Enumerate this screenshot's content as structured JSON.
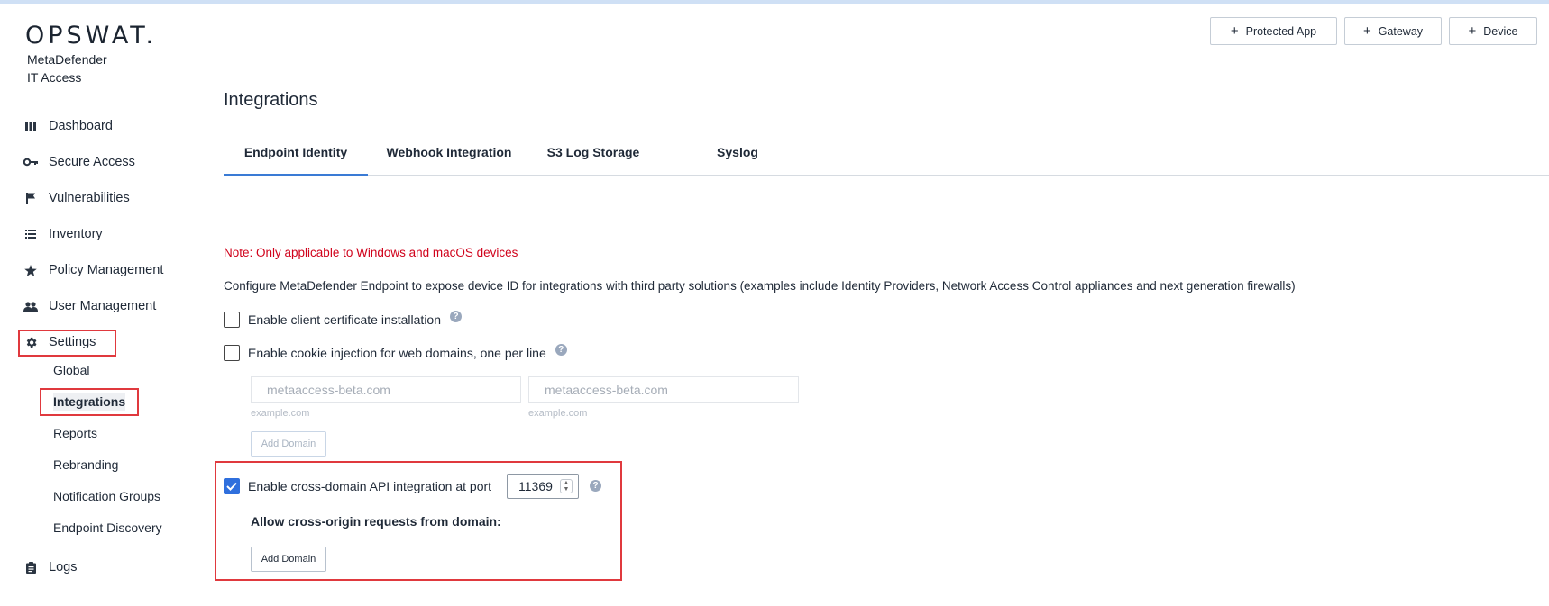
{
  "brand": {
    "logo": "OPSWAT.",
    "product_line1": "MetaDefender",
    "product_line2": "IT Access"
  },
  "header_buttons": [
    {
      "label": "Protected App"
    },
    {
      "label": "Gateway"
    },
    {
      "label": "Device"
    }
  ],
  "sidebar": {
    "items": [
      {
        "label": "Dashboard",
        "icon": "dashboard-icon"
      },
      {
        "label": "Secure Access",
        "icon": "key-icon"
      },
      {
        "label": "Vulnerabilities",
        "icon": "flag-icon"
      },
      {
        "label": "Inventory",
        "icon": "list-icon"
      },
      {
        "label": "Policy Management",
        "icon": "star-icon"
      },
      {
        "label": "User Management",
        "icon": "users-icon"
      },
      {
        "label": "Settings",
        "icon": "gear-icon"
      },
      {
        "label": "Logs",
        "icon": "clipboard-icon"
      }
    ],
    "settings_sub": [
      {
        "label": "Global"
      },
      {
        "label": "Integrations"
      },
      {
        "label": "Reports"
      },
      {
        "label": "Rebranding"
      },
      {
        "label": "Notification Groups"
      },
      {
        "label": "Endpoint Discovery"
      }
    ]
  },
  "page": {
    "title": "Integrations",
    "tabs": [
      {
        "label": "Endpoint Identity"
      },
      {
        "label": "Webhook Integration"
      },
      {
        "label": "S3 Log Storage"
      },
      {
        "label": "Syslog"
      }
    ],
    "note": "Note: Only applicable to Windows and macOS devices",
    "description": "Configure MetaDefender Endpoint to expose device ID for integrations with third party solutions (examples include Identity Providers, Network Access Control appliances and next generation firewalls)",
    "client_cert_label": "Enable client certificate installation",
    "cookie_label": "Enable cookie injection for web domains, one per line",
    "domain_placeholder_1": "metaaccess-beta.com",
    "domain_placeholder_2": "metaaccess-beta.com",
    "domain_hint_1": "example.com",
    "domain_hint_2": "example.com",
    "add_domain_label": "Add Domain",
    "cross_domain_label": "Enable cross-domain API integration at port",
    "port_value": "11369",
    "allow_label": "Allow cross-origin requests from domain:",
    "add_domain_label_2": "Add Domain",
    "help_glyph": "?"
  },
  "colors": {
    "accent": "#2f6fdd",
    "note": "#d0021b",
    "highlight": "#e0393e"
  }
}
